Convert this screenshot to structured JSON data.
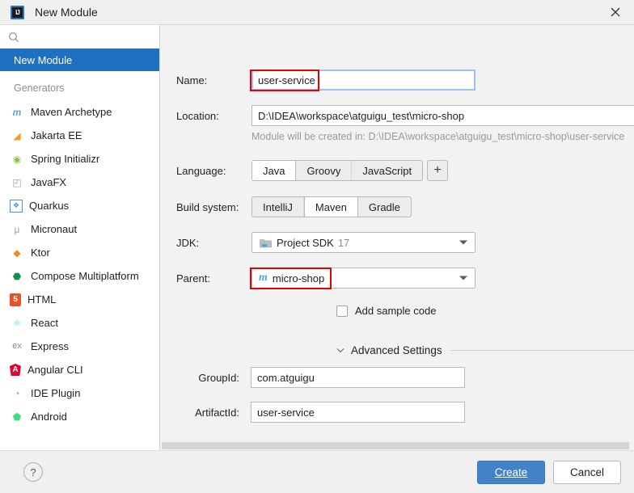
{
  "window": {
    "title": "New Module",
    "app_icon": "intellij-idea-icon",
    "close_icon": "close-icon"
  },
  "sidebar": {
    "search": {
      "value": "",
      "placeholder": "",
      "icon": "search-icon"
    },
    "selected_item": "New Module",
    "top_items": [
      {
        "label": "New Module",
        "selected": true
      }
    ],
    "group_label": "Generators",
    "generators": [
      {
        "label": "Maven Archetype",
        "icon": "maven-icon",
        "glyph": "m",
        "color": "#4ea6d9"
      },
      {
        "label": "Jakarta EE",
        "icon": "jakarta-ee-icon",
        "glyph": "◢",
        "color": "#f59b23"
      },
      {
        "label": "Spring Initializr",
        "icon": "spring-icon",
        "glyph": "◉",
        "color": "#8cc24a"
      },
      {
        "label": "JavaFX",
        "icon": "javafx-icon",
        "glyph": "◰",
        "color": "#9aa4ad"
      },
      {
        "label": "Quarkus",
        "icon": "quarkus-icon",
        "glyph": "❖",
        "color": "#4695eb"
      },
      {
        "label": "Micronaut",
        "icon": "micronaut-icon",
        "glyph": "μ",
        "color": "#9aa4ad"
      },
      {
        "label": "Ktor",
        "icon": "ktor-icon",
        "glyph": "◆",
        "color": "#f08a24"
      },
      {
        "label": "Compose Multiplatform",
        "icon": "compose-icon",
        "glyph": "⬣",
        "color": "#1e8a4c"
      },
      {
        "label": "HTML",
        "icon": "html5-icon",
        "glyph": "5",
        "color": "#e8512a"
      },
      {
        "label": "React",
        "icon": "react-icon",
        "glyph": "⚛",
        "color": "#61dafb"
      },
      {
        "label": "Express",
        "icon": "express-icon",
        "glyph": "ex",
        "color": "#8c8c8c"
      },
      {
        "label": "Angular CLI",
        "icon": "angular-icon",
        "glyph": "A",
        "color": "#dd0031"
      },
      {
        "label": "IDE Plugin",
        "icon": "ide-plugin-icon",
        "glyph": "◔",
        "color": "#9aa4ad"
      },
      {
        "label": "Android",
        "icon": "android-icon",
        "glyph": "⬟",
        "color": "#3ddc84"
      }
    ]
  },
  "form": {
    "name": {
      "label": "Name:",
      "value": "user-service",
      "placeholder": "",
      "annotated": true
    },
    "location": {
      "label": "Location:",
      "value": "D:\\IDEA\\workspace\\atguigu_test\\micro-shop",
      "placeholder": "",
      "browse_icon": "folder-browse-icon"
    },
    "location_hint": "Module will be created in: D:\\IDEA\\workspace\\atguigu_test\\micro-shop\\user-service",
    "language": {
      "label": "Language:",
      "options": [
        "Java",
        "Groovy",
        "JavaScript"
      ],
      "selected": "Java",
      "add_label": "+"
    },
    "build_system": {
      "label": "Build system:",
      "options": [
        "IntelliJ",
        "Maven",
        "Gradle"
      ],
      "selected": "Maven"
    },
    "jdk": {
      "label": "JDK:",
      "selected_text": "Project SDK",
      "selected_version": "17",
      "icon": "sdk-folder-icon",
      "arrow_icon": "chevron-down-icon"
    },
    "parent": {
      "label": "Parent:",
      "selected": "micro-shop",
      "icon": "maven-module-icon",
      "arrow_icon": "chevron-down-icon",
      "annotated": true
    },
    "add_sample_code": {
      "label": "Add sample code",
      "checked": false
    },
    "advanced": {
      "title": "Advanced Settings",
      "expanded": true,
      "chevron_icon": "chevron-down-icon",
      "group_id": {
        "label": "GroupId:",
        "value": "com.atguigu",
        "placeholder": ""
      },
      "artifact_id": {
        "label": "ArtifactId:",
        "value": "user-service",
        "placeholder": ""
      }
    }
  },
  "footer": {
    "help_label": "?",
    "help_icon": "help-icon",
    "create_label": "Create",
    "cancel_label": "Cancel"
  },
  "colors": {
    "accent": "#1f70c1",
    "primary_button": "#4381c9",
    "annotation": "#e60000",
    "focus_border": "#97c3f0"
  }
}
